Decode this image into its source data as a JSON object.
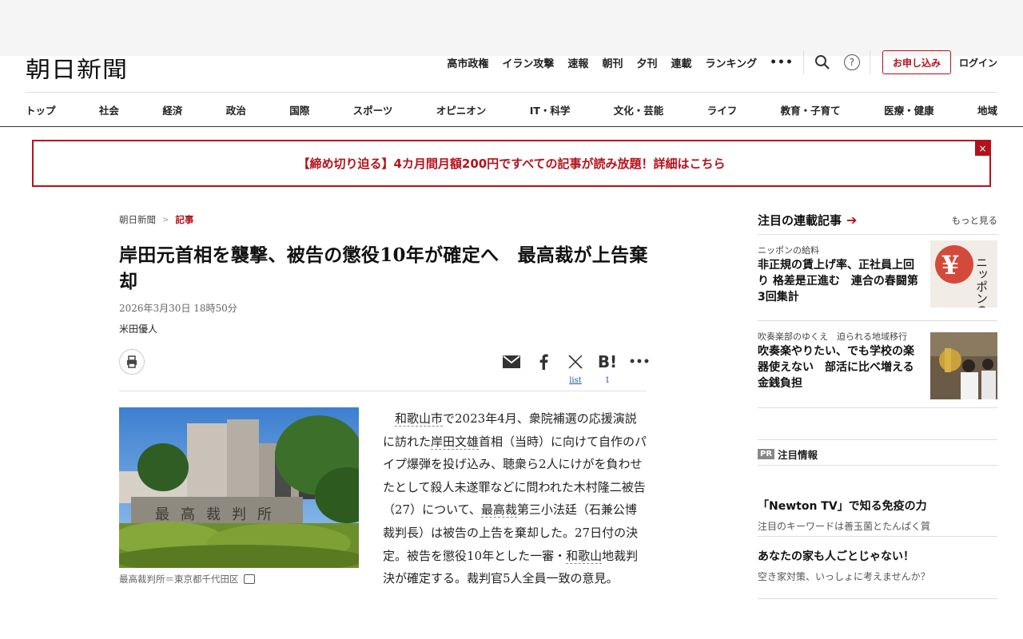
{
  "header": {
    "logo": "朝日新聞",
    "util_links": [
      "高市政権",
      "イラン攻撃",
      "速報",
      "朝刊",
      "夕刊",
      "連載",
      "ランキング"
    ],
    "more": "•••",
    "signup_label": "お申し込み",
    "login_label": "ログイン"
  },
  "nav": {
    "items": [
      "トップ",
      "社会",
      "経済",
      "政治",
      "国際",
      "スポーツ",
      "オピニオン",
      "IT・科学",
      "文化・芸能",
      "ライフ",
      "教育・子育て",
      "医療・健康",
      "地域"
    ]
  },
  "banner": {
    "text": "【締め切り迫る】4カ月間月額200円ですべての記事が読み放題！詳細はこちら",
    "close": "×"
  },
  "article": {
    "breadcrumb": {
      "home": "朝日新聞",
      "sep": ">",
      "current": "記事"
    },
    "title": "岸田元首相を襲撃、被告の懲役10年が確定へ　最高裁が上告棄却",
    "date": "2026年3月30日 18時50分",
    "author": "米田優人",
    "share": {
      "x_count": "list",
      "hatena_count": "1"
    },
    "photo_alt": "最高裁判所",
    "caption": "最高裁判所＝東京都千代田区",
    "body": {
      "p1": "和歌山市",
      "p2": "で2023年4月、衆院補選の応援演説に訪れた",
      "p3": "岸田文雄",
      "p4": "首相（当時）に向けて自作のパイプ爆弾を投げ込み、聴衆ら2人にけがを負わせたとして殺人未遂罪などに問われた木村隆二被告（27）について、",
      "p5": "最高裁",
      "p6": "第三小法廷（石兼公博裁判長）は被告の上告を棄却した。27日付の決定。被告を懲役10年とした一審・",
      "p7": "和歌山",
      "p8": "地裁判決が確定する。裁判官5人全員一致の意見。"
    }
  },
  "sidebar": {
    "title": "注目の連載記事",
    "arrow": "➔",
    "more": "もっと見る",
    "serials": [
      {
        "label": "ニッポンの給料",
        "title": "非正規の賃上げ率、正社員上回り 格差是正進む　連合の春闘第3回集計",
        "thumb_text": "ニッポンの給料"
      },
      {
        "label": "吹奏楽部のゆくえ　迫られる地域移行",
        "title": "吹奏楽やりたい、でも学校の楽器使えない　部活に比べ増える金銭負担"
      }
    ],
    "pr_badge": "PR",
    "pr_label": "注目情報",
    "pr_items": [
      {
        "title": "「Newton TV」で知る免疫の力",
        "sub": "注目のキーワードは善玉菌とたんぱく質"
      },
      {
        "title": "あなたの家も人ごとじゃない！",
        "sub": "空き家対策、いっしょに考えませんか？"
      }
    ]
  },
  "colors": {
    "accent": "#b5111b",
    "link": "#1a5aa8"
  },
  "icons": [
    "search-icon",
    "help-icon",
    "print-icon",
    "mail-icon",
    "facebook-icon",
    "x-icon",
    "hatena-icon",
    "more-icon",
    "image-icon",
    "arrow-right-icon"
  ]
}
